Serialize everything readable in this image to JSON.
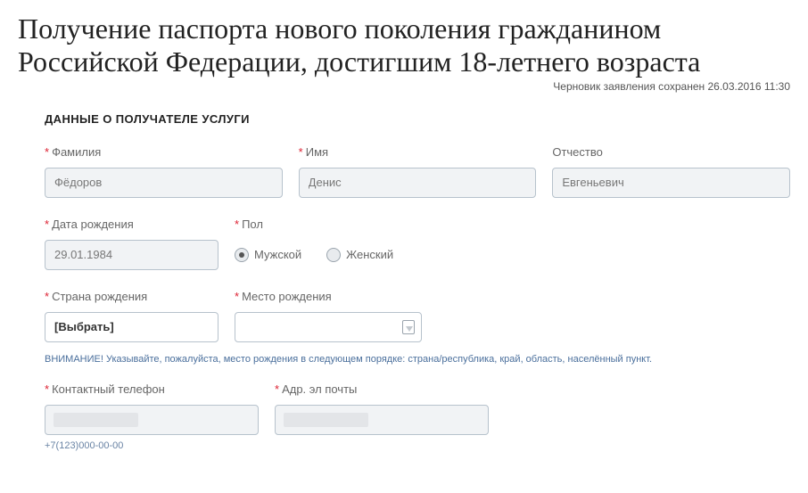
{
  "page_title": "Получение паспорта нового поколения гражданином Российской Федерации, достигшим 18-летнего возраста",
  "draft_status": "Черновик заявления сохранен 26.03.2016 11:30",
  "section_title": "ДАННЫЕ О ПОЛУЧАТЕЛЕ УСЛУГИ",
  "fields": {
    "surname": {
      "label": "Фамилия",
      "value": "Фёдоров"
    },
    "name": {
      "label": "Имя",
      "value": "Денис"
    },
    "patronymic": {
      "label": "Отчество",
      "value": "Евгеньевич"
    },
    "dob": {
      "label": "Дата рождения",
      "value": "29.01.1984"
    },
    "gender": {
      "label": "Пол",
      "selected": "male",
      "male_label": "Мужской",
      "female_label": "Женский"
    },
    "birth_country": {
      "label": "Страна рождения",
      "value": "[Выбрать]"
    },
    "birth_place": {
      "label": "Место рождения",
      "value": ""
    },
    "phone": {
      "label": "Контактный телефон",
      "value": "+",
      "hint": "+7(123)000-00-00"
    },
    "email": {
      "label": "Адр. эл почты",
      "value": ""
    }
  },
  "note": "ВНИМАНИЕ! Указывайте, пожалуйста, место рождения в следующем порядке: страна/республика, край, область, населённый пункт."
}
